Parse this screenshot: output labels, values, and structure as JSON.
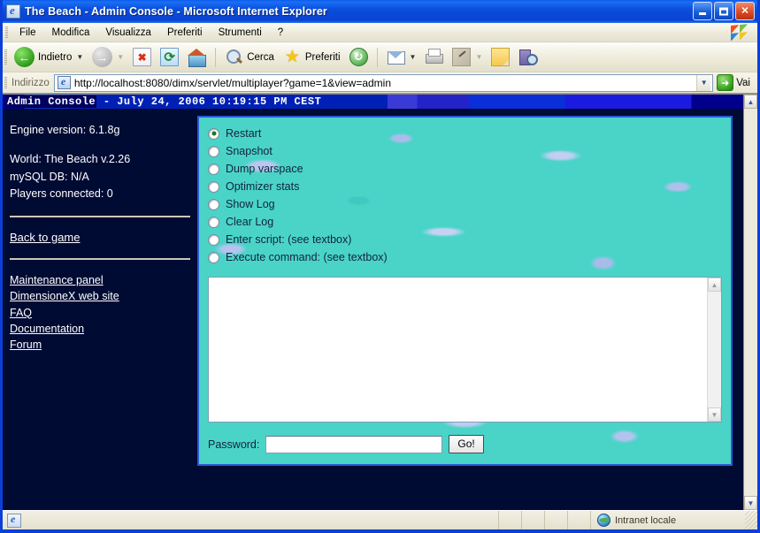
{
  "window": {
    "title": "The Beach - Admin Console - Microsoft Internet Explorer",
    "icon": "ie-document-icon",
    "minimize_label": "Minimize",
    "maximize_label": "Maximize",
    "close_label": "Close"
  },
  "menu": {
    "items": [
      {
        "label": "File"
      },
      {
        "label": "Modifica"
      },
      {
        "label": "Visualizza"
      },
      {
        "label": "Preferiti"
      },
      {
        "label": "Strumenti"
      },
      {
        "label": "?"
      }
    ]
  },
  "toolbar": {
    "back_label": "Indietro",
    "forward_label": "",
    "stop_label": "",
    "refresh_label": "",
    "home_label": "",
    "search_label": "Cerca",
    "favorites_label": "Preferiti",
    "history_label": "",
    "mail_label": "",
    "print_label": "",
    "edit_label": "",
    "notes_label": "",
    "research_label": ""
  },
  "address": {
    "label": "Indirizzo",
    "url": "http://localhost:8080/dimx/servlet/multiplayer?game=1&view=admin",
    "go_label": "Vai"
  },
  "page": {
    "header": {
      "app_name": "Admin Console",
      "separator": " - ",
      "timestamp": "July 24, 2006 10:19:15 PM CEST"
    },
    "sidebar": {
      "engine_version": "Engine version: 6.1.8g",
      "world": "World: The Beach v.2.26",
      "database": "mySQL DB: N/A",
      "players": "Players connected: 0",
      "back_link": "Back to game",
      "links": [
        {
          "label": "Maintenance panel"
        },
        {
          "label": "DimensioneX web site"
        },
        {
          "label": "FAQ"
        },
        {
          "label": "Documentation"
        },
        {
          "label": "Forum"
        }
      ]
    },
    "options": [
      {
        "label": "Restart",
        "checked": true
      },
      {
        "label": "Snapshot",
        "checked": false
      },
      {
        "label": "Dump varspace",
        "checked": false
      },
      {
        "label": "Optimizer stats",
        "checked": false
      },
      {
        "label": "Show Log",
        "checked": false
      },
      {
        "label": "Clear Log",
        "checked": false
      },
      {
        "label": "Enter script: (see textbox)",
        "checked": false
      },
      {
        "label": "Execute command: (see textbox)",
        "checked": false
      }
    ],
    "script_textarea": {
      "value": "",
      "placeholder": ""
    },
    "password": {
      "label": "Password:",
      "value": "",
      "placeholder": "",
      "submit_label": "Go!"
    }
  },
  "status": {
    "message": "",
    "zone": "Intranet locale"
  },
  "colors": {
    "titlebar_blue": "#0a43d2",
    "page_background": "#000b33",
    "water_turquoise": "#4ad4c8",
    "panel_border": "#2b59d8",
    "header_navy": "#00005f"
  }
}
